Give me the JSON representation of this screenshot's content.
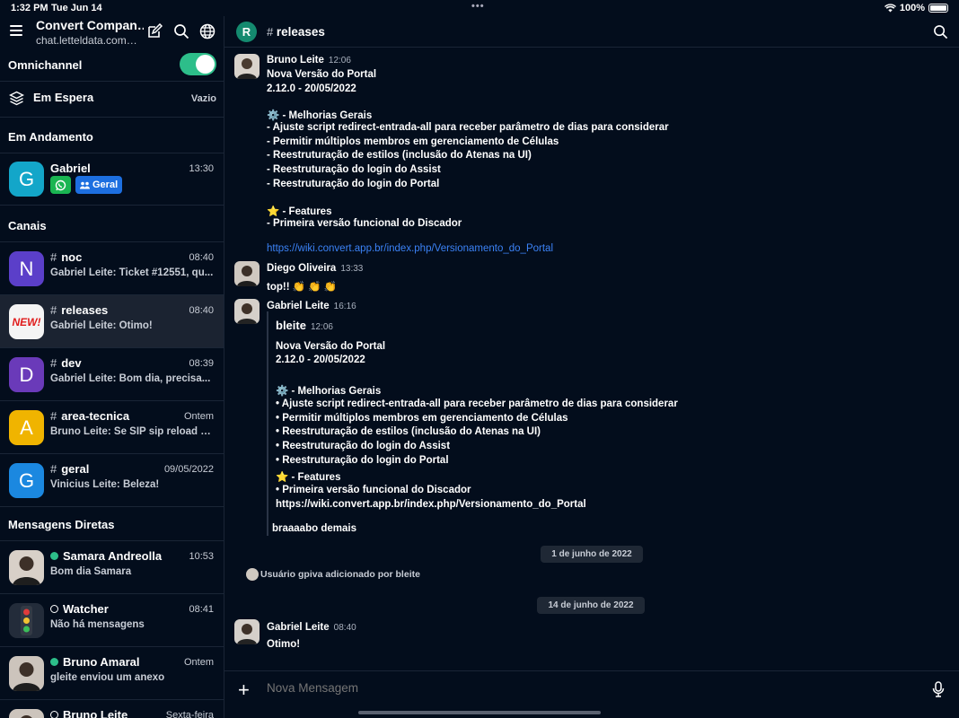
{
  "status_bar": {
    "time": "1:32 PM",
    "date": "Tue Jun 14",
    "battery": "100%"
  },
  "sidebar": {
    "workspace_title": "Convert Compan…",
    "workspace_sub": "chat.letteldata.com…",
    "omnichannel_label": "Omnichannel",
    "espera_label": "Em Espera",
    "espera_value": "Vazio",
    "section_andamento": "Em Andamento",
    "section_canais": "Canais",
    "section_diretas": "Mensagens Diretas",
    "andamento": {
      "name": "Gabriel",
      "time": "13:30",
      "avatar_letter": "G",
      "tag": "Geral"
    },
    "channels": [
      {
        "name": "noc",
        "last": "Gabriel Leite: Ticket #12551, qu...",
        "time": "08:40",
        "letter": "N",
        "color": "#5b3fc9"
      },
      {
        "name": "releases",
        "last": "Gabriel Leite: Otimo!",
        "time": "08:40",
        "letter": "NEW!",
        "color": "#f4f4f4"
      },
      {
        "name": "dev",
        "last": "Gabriel Leite: Bom dia, precisa...",
        "time": "08:39",
        "letter": "D",
        "color": "#6a3ab9"
      },
      {
        "name": "area-tecnica",
        "last": "Bruno Leite: Se SIP sip reload +...",
        "time": "Ontem",
        "letter": "A",
        "color": "#f0b400"
      },
      {
        "name": "geral",
        "last": "Vinicius Leite: Beleza!",
        "time": "09/05/2022",
        "letter": "G",
        "color": "#1b88e0"
      }
    ],
    "directs": [
      {
        "name": "Samara Andreolla",
        "last": "Bom dia Samara",
        "time": "10:53",
        "online": true
      },
      {
        "name": "Watcher",
        "last": "Não há mensagens",
        "time": "08:41",
        "online": false
      },
      {
        "name": "Bruno Amaral",
        "last": "gleite enviou um anexo",
        "time": "Ontem",
        "online": true
      },
      {
        "name": "Bruno Leite",
        "last": "",
        "time": "Sexta-feira",
        "online": false
      }
    ]
  },
  "room": {
    "avatar_letter": "R",
    "title": "releases"
  },
  "messages": {
    "m1": {
      "author": "Bruno Leite",
      "time": "12:06",
      "lines": [
        "Nova Versão do Portal",
        "2.12.0 - 20/05/2022",
        "⚙️ - Melhorias Gerais",
        "- Ajuste script redirect-entrada-all para receber parâmetro de dias para considerar",
        "- Permitir múltiplos membros em gerenciamento de Células",
        "- Reestruturação de estilos (inclusão do Atenas na UI)",
        "- Reestruturação do login do Assist",
        "- Reestruturação do login do Portal",
        "⭐ - Features",
        "- Primeira versão funcional do Discador"
      ],
      "link": "https://wiki.convert.app.br/index.php/Versionamento_do_Portal"
    },
    "m2": {
      "author": "Diego Oliveira",
      "time": "13:33",
      "text": "top!! 👏 👏 👏"
    },
    "m3": {
      "author": "Gabriel Leite",
      "time": "16:16",
      "quote_author": "bleite",
      "quote_time": "12:06",
      "quote_lines": [
        "Nova Versão do Portal",
        "2.12.0 - 20/05/2022",
        "⚙️ - Melhorias Gerais",
        "• Ajuste script redirect-entrada-all para receber parâmetro de dias para considerar",
        "• Permitir múltiplos membros em gerenciamento de Células",
        "• Reestruturação de estilos (inclusão do Atenas na UI)",
        "• Reestruturação do login do Assist",
        "• Reestruturação do login do Portal",
        "⭐ - Features",
        "• Primeira versão funcional do Discador",
        "https://wiki.convert.app.br/index.php/Versionamento_do_Portal"
      ],
      "text": "braaaabo demais"
    },
    "date1": "1 de junho de 2022",
    "system": "Usuário gpiva adicionado por bleite",
    "date2": "14 de junho de 2022",
    "m4": {
      "author": "Gabriel Leite",
      "time": "08:40",
      "text": "Otimo!"
    }
  },
  "composer": {
    "placeholder": "Nova Mensagem"
  }
}
